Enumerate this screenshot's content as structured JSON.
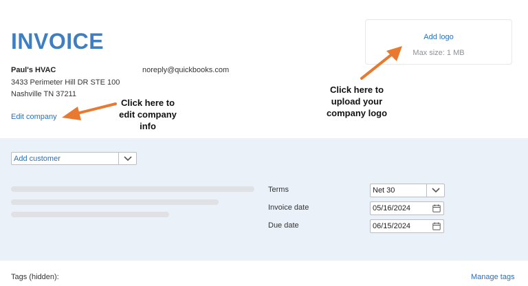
{
  "header": {
    "title": "INVOICE",
    "company": {
      "name": "Paul's HVAC",
      "address_line1": "3433 Perimeter Hill DR STE 100",
      "address_line2": "Nashville TN 37211",
      "email": "noreply@quickbooks.com",
      "edit_label": "Edit company"
    },
    "logo": {
      "add_label": "Add logo",
      "max_size": "Max size: 1 MB"
    }
  },
  "annotations": {
    "edit_company": [
      "Click here to",
      "edit company",
      "info"
    ],
    "upload_logo": [
      "Click here to",
      "upload your",
      "company logo"
    ],
    "arrow_color": "#e8792e"
  },
  "form": {
    "customer_placeholder": "Add customer",
    "terms_label": "Terms",
    "terms_value": "Net 30",
    "invoice_date_label": "Invoice date",
    "invoice_date_value": "05/16/2024",
    "due_date_label": "Due date",
    "due_date_value": "06/15/2024"
  },
  "footer": {
    "tags_label": "Tags (hidden):",
    "manage_tags": "Manage tags"
  },
  "colors": {
    "brand_blue": "#3d7fc2",
    "link_blue": "#2a6fbd",
    "panel_bg": "#eaf1f9"
  }
}
